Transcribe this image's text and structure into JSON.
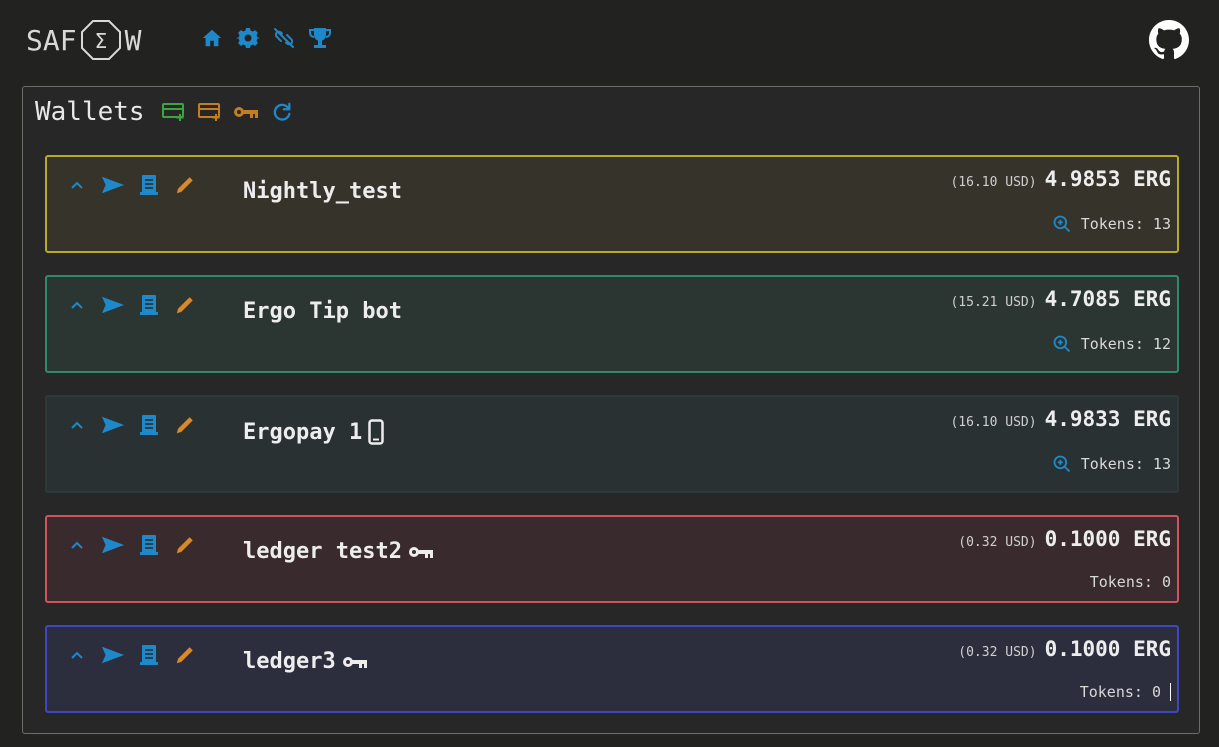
{
  "header": {
    "logo_left": "SAF",
    "logo_sigma": "Σ",
    "logo_right": "W",
    "nav_icons": [
      "home-icon",
      "gear-icon",
      "unlink-icon",
      "trophy-icon"
    ],
    "github_icon": "github-icon"
  },
  "wallets_panel": {
    "title": "Wallets",
    "head_icons": [
      "add-wallet-icon",
      "add-ergopay-wallet-icon",
      "key-icon",
      "refresh-icon"
    ]
  },
  "colors": {
    "accent_blue": "#1e88c8",
    "pencil_orange": "#d68a2a",
    "green_add": "#3fa33f",
    "orange_add": "#c47e22"
  },
  "wallets": [
    {
      "name": "Nightly_test",
      "usd": "(16.10 USD)",
      "erg": "4.9853 ERG",
      "tokens": "Tokens: 13",
      "has_token_search": true,
      "badge": "",
      "border": "#b5a92a",
      "bg": "#35332a"
    },
    {
      "name": "Ergo Tip bot",
      "usd": "(15.21 USD)",
      "erg": "4.7085 ERG",
      "tokens": "Tokens: 12",
      "has_token_search": true,
      "badge": "",
      "border": "#2f8a6c",
      "bg": "#2b3532"
    },
    {
      "name": "Ergopay 1",
      "usd": "(16.10 USD)",
      "erg": "4.9833 ERG",
      "tokens": "Tokens: 13",
      "has_token_search": true,
      "badge": "mobile-icon",
      "border": "#2c3a3a",
      "bg": "#2a3133"
    },
    {
      "name": "ledger test2",
      "usd": "(0.32 USD)",
      "erg": "0.1000 ERG",
      "tokens": "Tokens: 0",
      "has_token_search": false,
      "badge": "key-icon",
      "border": "#d0545c",
      "bg": "#392b2d"
    },
    {
      "name": "ledger3",
      "usd": "(0.32 USD)",
      "erg": "0.1000 ERG",
      "tokens": "Tokens: 0",
      "has_token_search": false,
      "badge": "key-icon",
      "border": "#3d47c4",
      "bg": "#2c2e3d"
    }
  ]
}
